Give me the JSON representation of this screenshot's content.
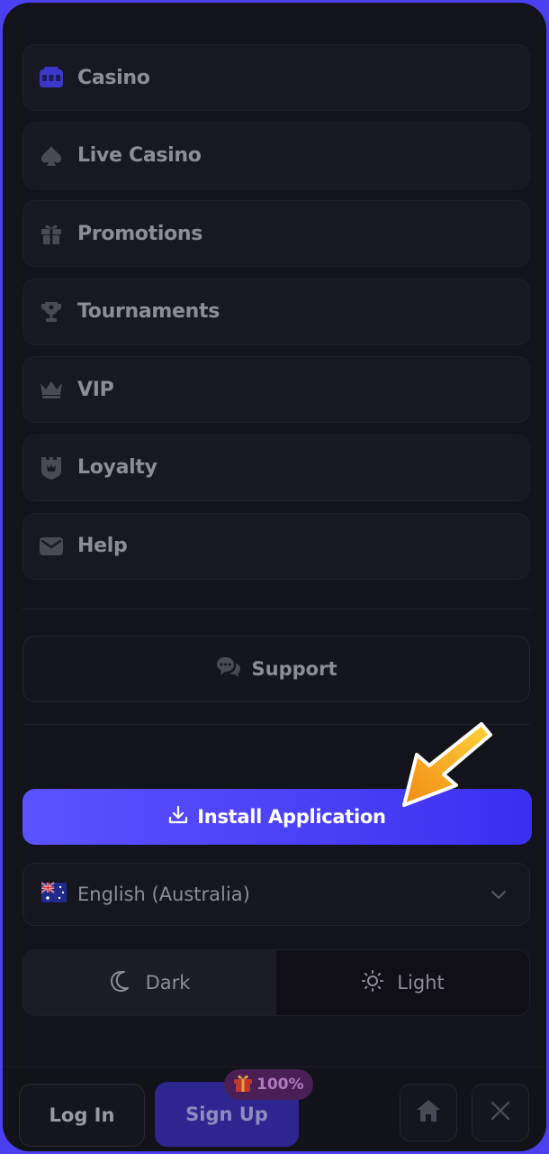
{
  "menu": {
    "items": [
      {
        "label": "Casino",
        "icon": "slot-machine-icon"
      },
      {
        "label": "Live Casino",
        "icon": "spade-icon"
      },
      {
        "label": "Promotions",
        "icon": "gift-icon"
      },
      {
        "label": "Tournaments",
        "icon": "trophy-icon"
      },
      {
        "label": "VIP",
        "icon": "crown-icon"
      },
      {
        "label": "Loyalty",
        "icon": "castle-badge-icon"
      },
      {
        "label": "Help",
        "icon": "envelope-icon"
      }
    ]
  },
  "support": {
    "label": "Support",
    "icon": "chat-bubbles-icon"
  },
  "install": {
    "label": "Install Application",
    "icon": "download-icon"
  },
  "language": {
    "label": "English (Australia)",
    "flag": "australia-flag-icon"
  },
  "theme": {
    "dark_label": "Dark",
    "light_label": "Light",
    "selected": "Dark"
  },
  "bottom_bar": {
    "login_label": "Log In",
    "signup_label": "Sign Up",
    "badge_label": "100%"
  },
  "colors": {
    "accent": "#4a3ff5",
    "frame": "#4b3ff0",
    "background": "#13131b",
    "arrow": "#f5a623"
  }
}
